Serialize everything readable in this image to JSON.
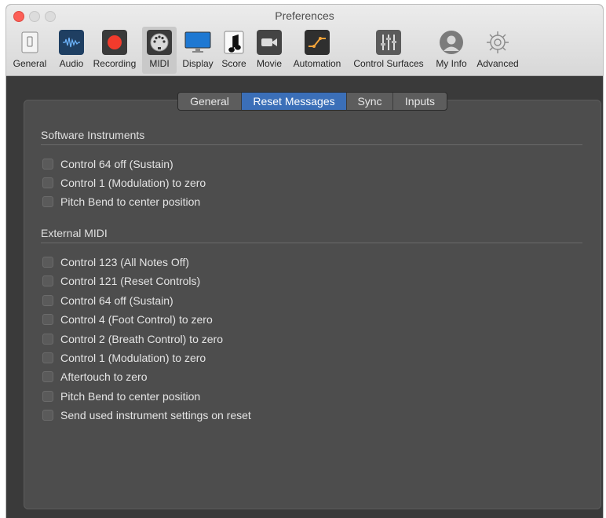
{
  "window": {
    "title": "Preferences"
  },
  "toolbar": {
    "items": [
      {
        "label": "General",
        "icon": "general-icon"
      },
      {
        "label": "Audio",
        "icon": "audio-icon"
      },
      {
        "label": "Recording",
        "icon": "recording-icon"
      },
      {
        "label": "MIDI",
        "icon": "midi-icon",
        "selected": true
      },
      {
        "label": "Display",
        "icon": "display-icon"
      },
      {
        "label": "Score",
        "icon": "score-icon"
      },
      {
        "label": "Movie",
        "icon": "movie-icon"
      },
      {
        "label": "Automation",
        "icon": "automation-icon"
      },
      {
        "label": "Control Surfaces",
        "icon": "control-surfaces-icon"
      },
      {
        "label": "My Info",
        "icon": "my-info-icon"
      },
      {
        "label": "Advanced",
        "icon": "advanced-icon"
      }
    ]
  },
  "tabs": [
    "General",
    "Reset Messages",
    "Sync",
    "Inputs"
  ],
  "active_tab": "Reset Messages",
  "software_instruments": {
    "title": "Software Instruments",
    "options": [
      {
        "label": "Control 64 off (Sustain)",
        "checked": false
      },
      {
        "label": "Control 1 (Modulation) to zero",
        "checked": false
      },
      {
        "label": "Pitch Bend to center position",
        "checked": false
      }
    ]
  },
  "external_midi": {
    "title": "External MIDI",
    "options": [
      {
        "label": "Control 123 (All Notes Off)",
        "checked": false
      },
      {
        "label": "Control 121 (Reset Controls)",
        "checked": false
      },
      {
        "label": "Control 64 off (Sustain)",
        "checked": false
      },
      {
        "label": "Control 4 (Foot Control) to zero",
        "checked": false
      },
      {
        "label": "Control 2 (Breath Control) to zero",
        "checked": false
      },
      {
        "label": "Control 1 (Modulation) to zero",
        "checked": false
      },
      {
        "label": "Aftertouch to zero",
        "checked": false
      },
      {
        "label": "Pitch Bend to center position",
        "checked": false
      },
      {
        "label": "Send used instrument settings on reset",
        "checked": false
      }
    ]
  },
  "colors": {
    "accent": "#3b6fb8",
    "record_red": "#f23b2c",
    "pane_bg": "#4d4d4d"
  }
}
